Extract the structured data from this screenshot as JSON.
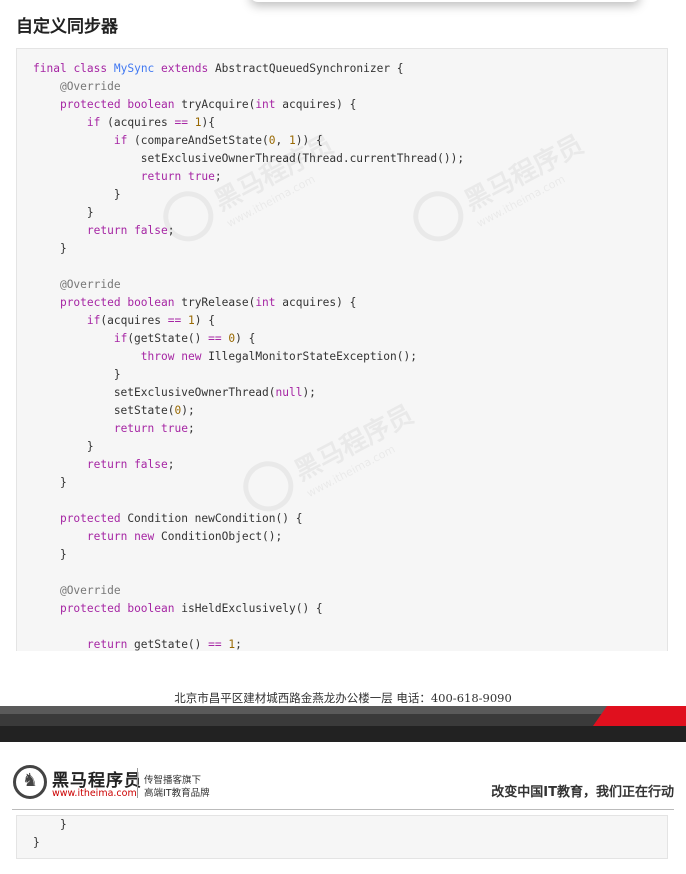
{
  "heading": "自定义同步器",
  "code_main": [
    [
      [
        "kw",
        "final"
      ],
      [
        "t",
        " "
      ],
      [
        "kw",
        "class"
      ],
      [
        "t",
        " "
      ],
      [
        "mn",
        "MySync"
      ],
      [
        "t",
        " "
      ],
      [
        "kw",
        "extends"
      ],
      [
        "t",
        " AbstractQueuedSynchronizer {"
      ]
    ],
    [
      [
        "t",
        "    "
      ],
      [
        "an",
        "@Override"
      ]
    ],
    [
      [
        "t",
        "    "
      ],
      [
        "kw",
        "protected"
      ],
      [
        "t",
        " "
      ],
      [
        "ty",
        "boolean"
      ],
      [
        "t",
        " tryAcquire("
      ],
      [
        "ty",
        "int"
      ],
      [
        "t",
        " acquires) {"
      ]
    ],
    [
      [
        "t",
        "        "
      ],
      [
        "kw",
        "if"
      ],
      [
        "t",
        " (acquires "
      ],
      [
        "op",
        "=="
      ],
      [
        "t",
        " "
      ],
      [
        "num",
        "1"
      ],
      [
        "t",
        "){"
      ]
    ],
    [
      [
        "t",
        "            "
      ],
      [
        "kw",
        "if"
      ],
      [
        "t",
        " (compareAndSetState("
      ],
      [
        "num",
        "0"
      ],
      [
        "t",
        ", "
      ],
      [
        "num",
        "1"
      ],
      [
        "t",
        ")) {"
      ]
    ],
    [
      [
        "t",
        "                setExclusiveOwnerThread(Thread.currentThread());"
      ]
    ],
    [
      [
        "t",
        "                "
      ],
      [
        "kw",
        "return"
      ],
      [
        "t",
        " "
      ],
      [
        "kw",
        "true"
      ],
      [
        "t",
        ";"
      ]
    ],
    [
      [
        "t",
        "            }"
      ]
    ],
    [
      [
        "t",
        "        }"
      ]
    ],
    [
      [
        "t",
        "        "
      ],
      [
        "kw",
        "return"
      ],
      [
        "t",
        " "
      ],
      [
        "kw",
        "false"
      ],
      [
        "t",
        ";"
      ]
    ],
    [
      [
        "t",
        "    }"
      ]
    ],
    [
      [
        "t",
        ""
      ]
    ],
    [
      [
        "t",
        "    "
      ],
      [
        "an",
        "@Override"
      ]
    ],
    [
      [
        "t",
        "    "
      ],
      [
        "kw",
        "protected"
      ],
      [
        "t",
        " "
      ],
      [
        "ty",
        "boolean"
      ],
      [
        "t",
        " tryRelease("
      ],
      [
        "ty",
        "int"
      ],
      [
        "t",
        " acquires) {"
      ]
    ],
    [
      [
        "t",
        "        "
      ],
      [
        "kw",
        "if"
      ],
      [
        "t",
        "(acquires "
      ],
      [
        "op",
        "=="
      ],
      [
        "t",
        " "
      ],
      [
        "num",
        "1"
      ],
      [
        "t",
        ") {"
      ]
    ],
    [
      [
        "t",
        "            "
      ],
      [
        "kw",
        "if"
      ],
      [
        "t",
        "(getState() "
      ],
      [
        "op",
        "=="
      ],
      [
        "t",
        " "
      ],
      [
        "num",
        "0"
      ],
      [
        "t",
        ") {"
      ]
    ],
    [
      [
        "t",
        "                "
      ],
      [
        "kw",
        "throw"
      ],
      [
        "t",
        " "
      ],
      [
        "kw",
        "new"
      ],
      [
        "t",
        " IllegalMonitorStateException();"
      ]
    ],
    [
      [
        "t",
        "            }"
      ]
    ],
    [
      [
        "t",
        "            setExclusiveOwnerThread("
      ],
      [
        "kw",
        "null"
      ],
      [
        "t",
        ");"
      ]
    ],
    [
      [
        "t",
        "            setState("
      ],
      [
        "num",
        "0"
      ],
      [
        "t",
        ");"
      ]
    ],
    [
      [
        "t",
        "            "
      ],
      [
        "kw",
        "return"
      ],
      [
        "t",
        " "
      ],
      [
        "kw",
        "true"
      ],
      [
        "t",
        ";"
      ]
    ],
    [
      [
        "t",
        "        }"
      ]
    ],
    [
      [
        "t",
        "        "
      ],
      [
        "kw",
        "return"
      ],
      [
        "t",
        " "
      ],
      [
        "kw",
        "false"
      ],
      [
        "t",
        ";"
      ]
    ],
    [
      [
        "t",
        "    }"
      ]
    ],
    [
      [
        "t",
        ""
      ]
    ],
    [
      [
        "t",
        "    "
      ],
      [
        "kw",
        "protected"
      ],
      [
        "t",
        " Condition newCondition() {"
      ]
    ],
    [
      [
        "t",
        "        "
      ],
      [
        "kw",
        "return"
      ],
      [
        "t",
        " "
      ],
      [
        "kw",
        "new"
      ],
      [
        "t",
        " ConditionObject();"
      ]
    ],
    [
      [
        "t",
        "    }"
      ]
    ],
    [
      [
        "t",
        ""
      ]
    ],
    [
      [
        "t",
        "    "
      ],
      [
        "an",
        "@Override"
      ]
    ],
    [
      [
        "t",
        "    "
      ],
      [
        "kw",
        "protected"
      ],
      [
        "t",
        " "
      ],
      [
        "ty",
        "boolean"
      ],
      [
        "t",
        " isHeldExclusively() {"
      ]
    ],
    [
      [
        "t",
        ""
      ]
    ],
    [
      [
        "t",
        "        "
      ],
      [
        "kw",
        "return"
      ],
      [
        "t",
        " getState() "
      ],
      [
        "op",
        "=="
      ],
      [
        "t",
        " "
      ],
      [
        "num",
        "1"
      ],
      [
        "t",
        ";"
      ]
    ]
  ],
  "code_cont": [
    [
      [
        "t",
        "    }"
      ]
    ],
    [
      [
        "t",
        "}"
      ]
    ]
  ],
  "watermark": {
    "brand": "黑马程序员",
    "url": "www.itheima.com"
  },
  "footer": {
    "address": "北京市昌平区建材城西路金燕龙办公楼一层    电话：400-618-9090"
  },
  "header": {
    "logo_name": "黑马程序员",
    "logo_url": "www.itheima.com",
    "tagline1": "传智播客旗下",
    "tagline2": "高端IT教育品牌",
    "slogan": "改变中国IT教育，我们正在行动"
  },
  "colors": {
    "keyword": "#a626a4",
    "class_name": "#4078f2",
    "number": "#986801",
    "annotation": "#777777",
    "accent_red": "#e0101e"
  }
}
